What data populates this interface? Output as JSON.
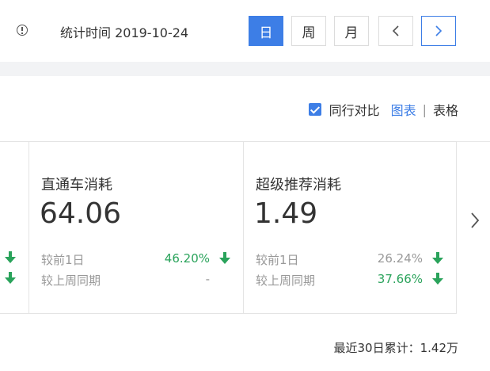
{
  "header": {
    "stat_time_label": "统计时间 2019-10-24",
    "period_buttons": [
      "日",
      "周",
      "月"
    ],
    "active_period": "日"
  },
  "compare": {
    "label": "同行对比",
    "checked": true,
    "view_chart": "图表",
    "view_separator": "|",
    "view_table": "表格"
  },
  "cards": [
    {
      "title": "直通车消耗",
      "value": "64.06",
      "rows": [
        {
          "label": "较前1日",
          "value": "46.20%",
          "trend": "down",
          "color": "#2aa35b"
        },
        {
          "label": "较上周同期",
          "value": "-",
          "trend": "none",
          "color": "#999999"
        }
      ]
    },
    {
      "title": "超级推荐消耗",
      "value": "1.49",
      "rows": [
        {
          "label": "较前1日",
          "value": "26.24%",
          "trend": "down",
          "color": "#999999"
        },
        {
          "label": "较上周同期",
          "value": "37.66%",
          "trend": "down",
          "color": "#2aa35b"
        }
      ]
    }
  ],
  "footer": {
    "total_label": "最近30日累计：1.42万"
  },
  "colors": {
    "accent": "#3d7ee6",
    "down_green": "#2aa35b"
  },
  "icons": {
    "info": "info-circle-icon",
    "prev": "chevron-left-icon",
    "next": "chevron-right-icon",
    "trend_down": "arrow-down-icon",
    "carousel_next": "chevron-right-icon"
  }
}
